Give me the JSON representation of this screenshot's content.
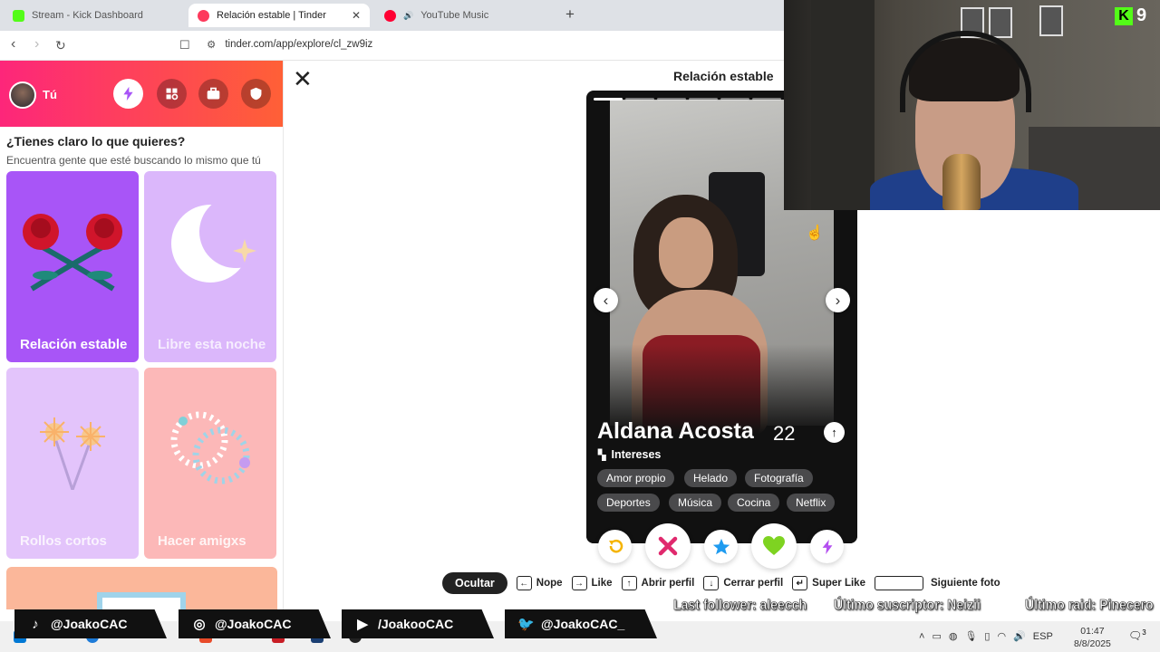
{
  "browser": {
    "tabs": [
      {
        "title": "Stream - Kick Dashboard",
        "color": "#53fc18"
      },
      {
        "title": "Relación estable | Tinder",
        "color": "#fd3a5c"
      },
      {
        "title": "YouTube Music",
        "color": "#ff0033"
      }
    ],
    "new_tab": "+",
    "url": "tinder.com/app/explore/cl_zw9iz"
  },
  "sidebar": {
    "user": "Tú",
    "header_buttons": [
      "bolt-icon",
      "explore-icon",
      "briefcase-icon",
      "shield-icon"
    ],
    "question_title": "¿Tienes claro lo que quieres?",
    "question_subtitle": "Encuentra gente que esté buscando lo mismo que tú",
    "cards": [
      {
        "label": "Relación estable",
        "color": "#a855f7"
      },
      {
        "label": "Libre esta noche",
        "color": "#dbb7fb"
      },
      {
        "label": "Rollos cortos",
        "color": "#e3c4fb"
      },
      {
        "label": "Hacer amigxs",
        "color": "#fcb8b8"
      }
    ]
  },
  "main": {
    "title": "Relación estable",
    "profile": {
      "name": "Aldana Acosta",
      "age": "22",
      "interests_title": "Intereses",
      "interests": [
        "Amor propio",
        "Helado",
        "Fotografía",
        "Deportes",
        "Música",
        "Cocina",
        "Netflix"
      ],
      "photo_count": 9,
      "current_photo": 1
    },
    "actions": [
      "rewind-icon",
      "nope-icon",
      "super-like-icon",
      "like-icon",
      "boost-icon"
    ],
    "shortcuts": {
      "hide": "Ocultar",
      "items": [
        {
          "key": "←",
          "label": "Nope"
        },
        {
          "key": "→",
          "label": "Like"
        },
        {
          "key": "↑",
          "label": "Abrir perfil"
        },
        {
          "key": "↓",
          "label": "Cerrar perfil"
        },
        {
          "key": "↵",
          "label": "Super Like"
        }
      ],
      "next_photo": "Siguiente foto"
    }
  },
  "stream": {
    "viewer_count": "9",
    "socials": [
      {
        "icon": "tiktok-icon",
        "handle": "@JoakoCAC"
      },
      {
        "icon": "instagram-icon",
        "handle": "@JoakoCAC"
      },
      {
        "icon": "youtube-icon",
        "handle": "/JoakooCAC"
      },
      {
        "icon": "twitter-icon",
        "handle": "@JoakoCAC_"
      }
    ],
    "last_follower": "Last follower: aleecch",
    "last_sub": "Último suscriptor: Neizii",
    "last_raid": "Último raid: Pinecero"
  },
  "taskbar": {
    "lang": "ESP",
    "time": "01:47",
    "date": "8/8/2025",
    "notifications": "3"
  }
}
